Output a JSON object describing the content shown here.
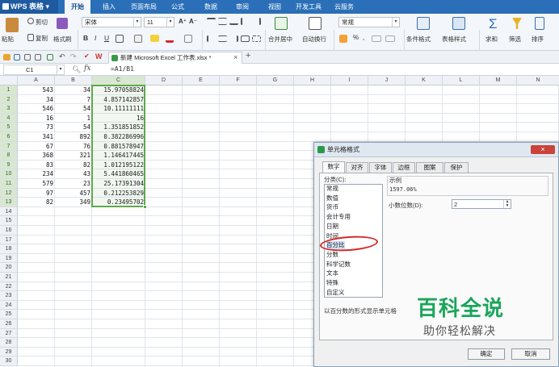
{
  "app": {
    "brand": "WPS 表格",
    "brand_dropdown": "▾"
  },
  "menu_tabs": [
    "开始",
    "插入",
    "页面布局",
    "公式",
    "数据",
    "审阅",
    "视图",
    "开发工具",
    "云服务"
  ],
  "ribbon": {
    "cut": "剪切",
    "paste": "粘贴",
    "copy": "复制",
    "format_painter": "格式刷",
    "font_name": "宋体",
    "font_size": "11",
    "font_grow": "A⁺",
    "font_shrink": "A⁻",
    "bold": "B",
    "italic": "I",
    "underline": "U",
    "merge_center": "合并居中",
    "wrap_text": "自动换行",
    "number_format": "常规",
    "percent": "%",
    "thousands": ",",
    "conditional_format": "条件格式",
    "table_style": "表格样式",
    "sum": "求和",
    "filter": "筛选",
    "sort": "排序"
  },
  "document_tab": {
    "title": "新建 Microsoft Excel 工作表.xlsx *",
    "close": "×",
    "add": "+"
  },
  "formula_bar": {
    "name_box": "C1",
    "fx": "fx",
    "formula": "=A1/B1"
  },
  "columns": [
    "A",
    "B",
    "C",
    "D",
    "E",
    "F",
    "G",
    "H",
    "I",
    "J",
    "K",
    "L",
    "M",
    "N"
  ],
  "rows": [
    "1",
    "2",
    "3",
    "4",
    "5",
    "6",
    "7",
    "8",
    "9",
    "10",
    "11",
    "12",
    "13",
    "14",
    "15",
    "16",
    "17",
    "18",
    "19",
    "20",
    "21",
    "22",
    "23",
    "24",
    "25",
    "26",
    "27",
    "28",
    "29",
    "30"
  ],
  "sheet_data": [
    [
      "543",
      "34",
      "15.97058824"
    ],
    [
      "34",
      "7",
      "4.857142857"
    ],
    [
      "546",
      "54",
      "10.11111111"
    ],
    [
      "16",
      "1",
      "16"
    ],
    [
      "73",
      "54",
      "1.351851852"
    ],
    [
      "341",
      "892",
      "0.382286996"
    ],
    [
      "67",
      "76",
      "0.881578947"
    ],
    [
      "368",
      "321",
      "1.146417445"
    ],
    [
      "83",
      "82",
      "1.012195122"
    ],
    [
      "234",
      "43",
      "5.441860465"
    ],
    [
      "579",
      "23",
      "25.17391304"
    ],
    [
      "97",
      "457",
      "0.212253829"
    ],
    [
      "82",
      "349",
      "0.23495702"
    ]
  ],
  "dialog": {
    "title": "单元格格式",
    "close": "×",
    "tabs": [
      "数字",
      "对齐",
      "字体",
      "边框",
      "图案",
      "保护"
    ],
    "category_label": "分类(C):",
    "categories": [
      "常规",
      "数值",
      "货币",
      "会计专用",
      "日期",
      "时间",
      "百分比",
      "分数",
      "科学记数",
      "文本",
      "特殊",
      "自定义"
    ],
    "selected_category": "百分比",
    "sample_label": "示例",
    "sample_value": "1597.06%",
    "decimals_label": "小数位数(D):",
    "decimals_value": "2",
    "description": "以百分数的形式显示单元格",
    "ok": "确定",
    "cancel": "取消"
  },
  "watermark": {
    "title": "百科全说",
    "subtitle": "助你轻松解决"
  },
  "colors": {
    "accent": "#2a6fb8",
    "selection": "#5fa84f",
    "highlight_circle": "#d42a2a",
    "watermark": "#1aa55a"
  }
}
